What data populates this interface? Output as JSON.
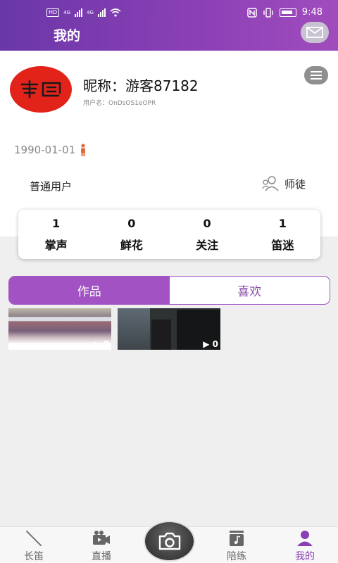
{
  "status_bar": {
    "hd": "HD",
    "net1": "4G",
    "net2": "4G",
    "time": "9:48"
  },
  "header": {
    "title": "我的",
    "mail_icon": "envelope-icon"
  },
  "profile": {
    "nickname": "昵称：游客87182",
    "username": "用户名：OnDsOS1eOPR",
    "birthday": "1990-01-01",
    "user_type": "普通用户",
    "mentor_label": "师徒",
    "avatar_color": "#e2231a"
  },
  "stats": [
    {
      "value": "1",
      "label": "掌声"
    },
    {
      "value": "0",
      "label": "鲜花"
    },
    {
      "value": "0",
      "label": "关注"
    },
    {
      "value": "1",
      "label": "笛迷"
    }
  ],
  "tabs": [
    {
      "label": "作品",
      "active": true
    },
    {
      "label": "喜欢",
      "active": false
    }
  ],
  "works": [
    {
      "play_count": "0"
    },
    {
      "play_count": "0"
    }
  ],
  "bottom_nav": [
    {
      "label": "长笛",
      "icon": "flute-icon"
    },
    {
      "label": "直播",
      "icon": "video-camera-icon"
    },
    {
      "label": "陪练",
      "icon": "music-note-icon"
    },
    {
      "label": "我的",
      "icon": "person-icon",
      "active": true
    }
  ],
  "colors": {
    "accent": "#8a3fb5",
    "tab_active": "#a252c2"
  }
}
